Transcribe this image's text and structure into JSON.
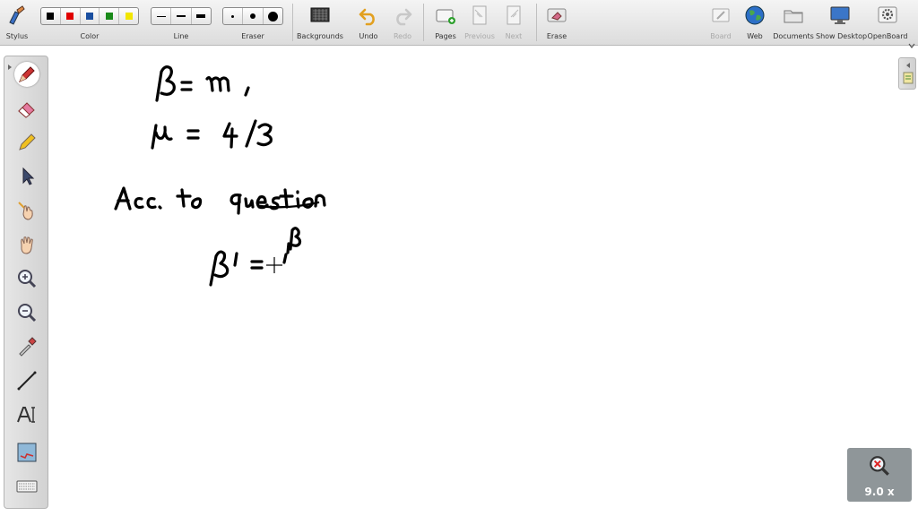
{
  "toolbar": {
    "stylus": "Stylus",
    "color": "Color",
    "line": "Line",
    "eraser": "Eraser",
    "backgrounds": "Backgrounds",
    "undo": "Undo",
    "redo": "Redo",
    "pages": "Pages",
    "previous": "Previous",
    "next": "Next",
    "erase": "Erase",
    "board": "Board",
    "web": "Web",
    "documents": "Documents",
    "show_desktop": "Show Desktop",
    "openboard": "OpenBoard"
  },
  "colors": {
    "swatches": [
      "#000000",
      "#e00000",
      "#1a4fa0",
      "#1a8a1a",
      "#f2e600"
    ],
    "accent": "#8f9699"
  },
  "side_tools": [
    "pen-icon",
    "eraser-icon",
    "marker-icon",
    "pointer-icon",
    "laser-hand-icon",
    "hand-icon",
    "zoom-in-icon",
    "zoom-out-icon",
    "picker-icon",
    "line-icon",
    "text-icon",
    "capture-icon",
    "keyboard-icon"
  ],
  "zoom": {
    "level": "9.0 x"
  }
}
